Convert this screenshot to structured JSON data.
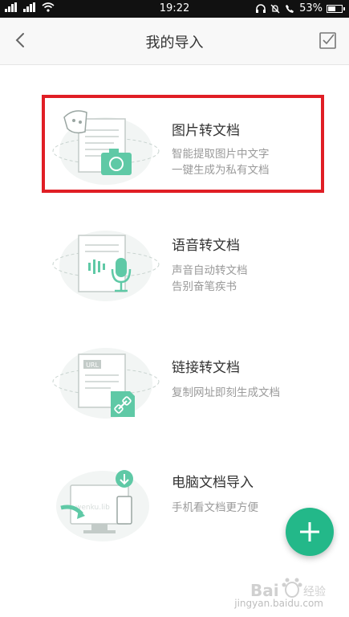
{
  "status": {
    "time": "19:22",
    "battery": "53%",
    "signal": "3هlll"
  },
  "header": {
    "title": "我的导入"
  },
  "items": [
    {
      "title": "图片转文档",
      "desc1": "智能提取图片中文字",
      "desc2": "一键生成为私有文档"
    },
    {
      "title": "语音转文档",
      "desc1": "声音自动转文档",
      "desc2": "告别奋笔疾书"
    },
    {
      "title": "链接转文档",
      "desc1": "复制网址即刻生成文档",
      "desc2": ""
    },
    {
      "title": "电脑文档导入",
      "desc1": "手机看文档更方便",
      "desc2": ""
    }
  ],
  "illustration_text": {
    "url_tag": "URL",
    "wenku_watermark": "wenku.lib"
  },
  "watermark": {
    "brand": "Bai",
    "sub": "jingyan.baidu.com"
  },
  "colors": {
    "accent": "#23b889",
    "highlight": "#e01e25"
  }
}
